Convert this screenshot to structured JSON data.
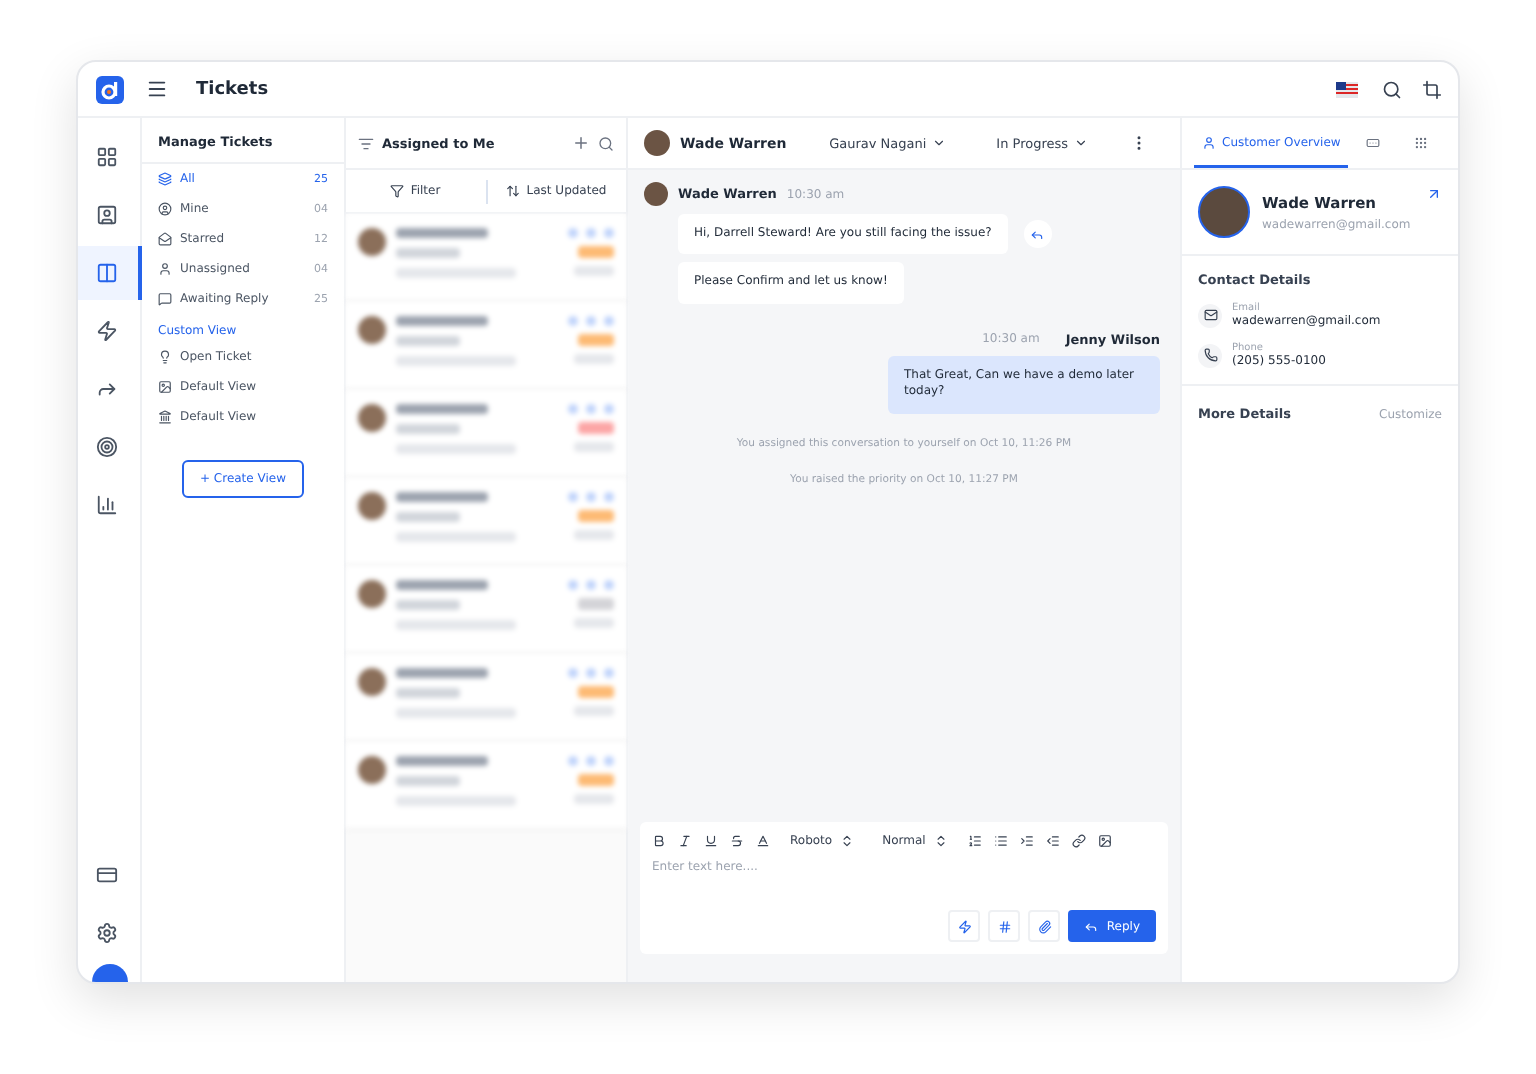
{
  "topbar": {
    "title": "Tickets"
  },
  "rail": [
    {
      "selected": false
    },
    {
      "selected": false
    },
    {
      "selected": true
    },
    {
      "selected": false
    },
    {
      "selected": false
    },
    {
      "selected": false
    },
    {
      "selected": false
    }
  ],
  "manage": {
    "title": "Manage Tickets",
    "items": [
      {
        "label": "All",
        "count": "25",
        "selected": true
      },
      {
        "label": "Mine",
        "count": "04",
        "selected": false
      },
      {
        "label": "Starred",
        "count": "12",
        "selected": false
      },
      {
        "label": "Unassigned",
        "count": "04",
        "selected": false
      },
      {
        "label": "Awaiting Reply",
        "count": "25",
        "selected": false
      }
    ],
    "custom_title": "Custom View",
    "custom_items": [
      "Open Ticket",
      "Default View",
      "Default View"
    ],
    "create_button": "+ Create View"
  },
  "ticket_list": {
    "title": "Assigned to Me",
    "filter": "Filter",
    "sort": "Last Updated",
    "tickets": [
      {
        "color": "#fdba74"
      },
      {
        "color": "#fdba74"
      },
      {
        "color": "#fca5a5"
      },
      {
        "color": "#fdba74"
      },
      {
        "color": "#d4d4d8"
      },
      {
        "color": "#fdba74"
      },
      {
        "color": "#fdba74"
      }
    ]
  },
  "chat": {
    "contact": "Wade Warren",
    "assignee": "Gaurav Nagani",
    "status": "In Progress",
    "incoming": {
      "name": "Wade Warren",
      "time": "10:30 am",
      "messages": [
        "Hi, Darrell Steward! Are you still facing the issue?",
        "Please Confirm and let us know!"
      ]
    },
    "outgoing": {
      "name": "Jenny Wilson",
      "time": "10:30 am",
      "message": "That Great, Can we have a demo later today?"
    },
    "events": [
      "You assigned this conversation to yourself on Oct 10, 11:26 PM",
      "You raised the priority on Oct 10, 11:27 PM"
    ],
    "editor": {
      "font": "Roboto",
      "size": "Normal",
      "placeholder": "Enter text here....",
      "reply": "Reply"
    }
  },
  "customer": {
    "tabs": [
      {
        "label": "Customer Overview",
        "selected": true
      },
      {
        "selected": false
      },
      {
        "selected": false
      }
    ],
    "name": "Wade Warren",
    "email": "wadewarren@gmail.com",
    "contact_title": "Contact Details",
    "fields": [
      {
        "label": "Email",
        "value": "wadewarren@gmail.com"
      },
      {
        "label": "Phone",
        "value": "(205) 555-0100"
      }
    ],
    "more_title": "More Details",
    "customize": "Customize"
  }
}
